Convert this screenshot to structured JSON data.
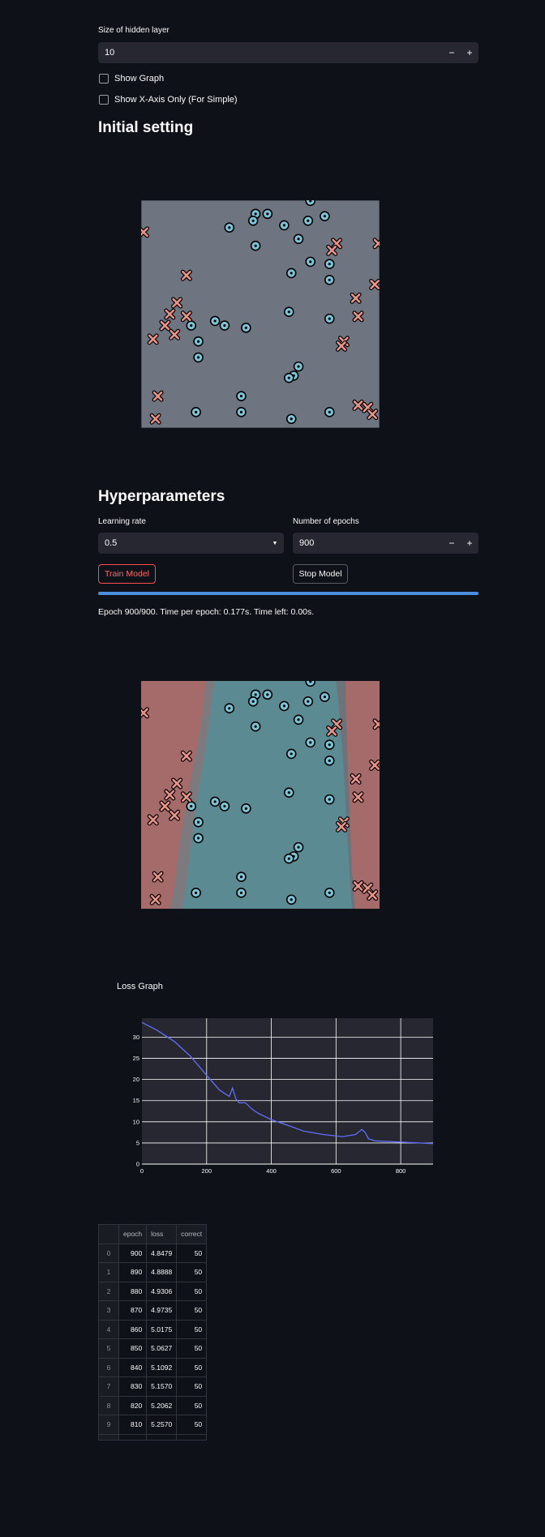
{
  "hidden_layer": {
    "label": "Size of hidden layer",
    "value": "10",
    "minus": "−",
    "plus": "+"
  },
  "checkboxes": {
    "show_graph": "Show Graph",
    "show_x_axis": "Show X-Axis Only (For Simple)"
  },
  "initial": {
    "title": "Initial setting"
  },
  "hyper": {
    "title": "Hyperparameters",
    "lr_label": "Learning rate",
    "lr_value": "0.5",
    "epochs_label": "Number of epochs",
    "epochs_value": "900",
    "minus": "−",
    "plus": "+",
    "train": "Train Model",
    "stop": "Stop Model",
    "progress_fraction": 1.0,
    "status": "Epoch 900/900. Time per epoch: 0.177s. Time left: 0.00s."
  },
  "colors": {
    "accent": "#ff4b4b",
    "progress": "#4a8fe0",
    "class_a": "#e8948a",
    "class_b": "#7fc4d6"
  },
  "scatter_points": {
    "circles": [
      [
        0.71,
        0.997
      ],
      [
        0.48,
        0.94
      ],
      [
        0.53,
        0.94
      ],
      [
        0.7,
        0.91
      ],
      [
        0.77,
        0.93
      ],
      [
        0.47,
        0.91
      ],
      [
        0.37,
        0.88
      ],
      [
        0.6,
        0.89
      ],
      [
        0.66,
        0.83
      ],
      [
        0.48,
        0.8
      ],
      [
        0.71,
        0.73
      ],
      [
        0.79,
        0.72
      ],
      [
        0.63,
        0.68
      ],
      [
        0.79,
        0.65
      ],
      [
        0.62,
        0.51
      ],
      [
        0.79,
        0.48
      ],
      [
        0.31,
        0.47
      ],
      [
        0.21,
        0.45
      ],
      [
        0.35,
        0.45
      ],
      [
        0.44,
        0.44
      ],
      [
        0.24,
        0.38
      ],
      [
        0.24,
        0.31
      ],
      [
        0.66,
        0.27
      ],
      [
        0.64,
        0.23
      ],
      [
        0.62,
        0.22
      ],
      [
        0.42,
        0.14
      ],
      [
        0.23,
        0.07
      ],
      [
        0.42,
        0.07
      ],
      [
        0.79,
        0.07
      ],
      [
        0.63,
        0.04
      ]
    ],
    "crosses": [
      [
        0.01,
        0.86
      ],
      [
        0.82,
        0.81
      ],
      [
        0.8,
        0.78
      ],
      [
        0.995,
        0.81
      ],
      [
        0.19,
        0.67
      ],
      [
        0.98,
        0.63
      ],
      [
        0.9,
        0.57
      ],
      [
        0.15,
        0.55
      ],
      [
        0.12,
        0.5
      ],
      [
        0.19,
        0.49
      ],
      [
        0.91,
        0.49
      ],
      [
        0.1,
        0.45
      ],
      [
        0.14,
        0.41
      ],
      [
        0.05,
        0.39
      ],
      [
        0.85,
        0.38
      ],
      [
        0.84,
        0.36
      ],
      [
        0.07,
        0.14
      ],
      [
        0.06,
        0.04
      ],
      [
        0.91,
        0.1
      ],
      [
        0.95,
        0.09
      ],
      [
        0.97,
        0.06
      ]
    ]
  },
  "loss": {
    "title": "Loss Graph"
  },
  "chart_data": {
    "type": "line",
    "title": "",
    "xlabel": "",
    "ylabel": "",
    "xlim": [
      0,
      900
    ],
    "ylim": [
      0,
      34.5
    ],
    "x_ticks": [
      0,
      200,
      400,
      600,
      800
    ],
    "y_ticks": [
      0,
      5,
      10,
      15,
      20,
      25,
      30
    ],
    "series": [
      {
        "color": "#636efa",
        "x": [
          0,
          50,
          100,
          150,
          200,
          240,
          270,
          280,
          290,
          300,
          320,
          340,
          360,
          400,
          450,
          500,
          560,
          620,
          660,
          680,
          690,
          700,
          720,
          800,
          900
        ],
        "y": [
          33.5,
          31.5,
          29.0,
          25.5,
          21.0,
          17.5,
          16.0,
          18.0,
          15.5,
          14.5,
          14.5,
          13.0,
          12.0,
          10.5,
          9.2,
          7.8,
          7.0,
          6.5,
          7.0,
          8.2,
          7.5,
          6.0,
          5.5,
          5.2,
          4.85
        ]
      }
    ]
  },
  "table": {
    "headers": [
      "",
      "epoch",
      "loss",
      "correct"
    ],
    "rows": [
      [
        "0",
        "900",
        "4.8479",
        "50"
      ],
      [
        "1",
        "890",
        "4.8888",
        "50"
      ],
      [
        "2",
        "880",
        "4.9306",
        "50"
      ],
      [
        "3",
        "870",
        "4.9735",
        "50"
      ],
      [
        "4",
        "860",
        "5.0175",
        "50"
      ],
      [
        "5",
        "850",
        "5.0627",
        "50"
      ],
      [
        "6",
        "840",
        "5.1092",
        "50"
      ],
      [
        "7",
        "830",
        "5.1570",
        "50"
      ],
      [
        "8",
        "820",
        "5.2062",
        "50"
      ],
      [
        "9",
        "810",
        "5.2570",
        "50"
      ]
    ]
  }
}
